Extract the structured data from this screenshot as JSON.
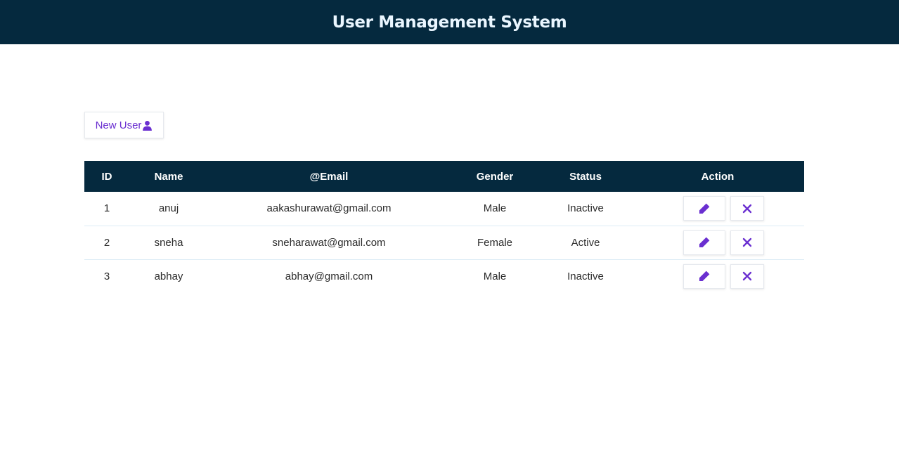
{
  "header": {
    "title": "User Management System"
  },
  "toolbar": {
    "new_user_label": "New User",
    "new_user_icon": "user-icon"
  },
  "table": {
    "columns": [
      "ID",
      "Name",
      "@Email",
      "Gender",
      "Status",
      "Action"
    ],
    "rows": [
      {
        "id": "1",
        "name": "anuj",
        "email": "aakashurawat@gmail.com",
        "gender": "Male",
        "status": "Inactive"
      },
      {
        "id": "2",
        "name": "sneha",
        "email": "sneharawat@gmail.com",
        "gender": "Female",
        "status": "Active"
      },
      {
        "id": "3",
        "name": "abhay",
        "email": "abhay@gmail.com",
        "gender": "Male",
        "status": "Inactive"
      }
    ],
    "row_actions": [
      "pencil-icon",
      "close-icon"
    ]
  },
  "colors": {
    "header_bg": "#05293e",
    "accent": "#6a2fd0"
  }
}
